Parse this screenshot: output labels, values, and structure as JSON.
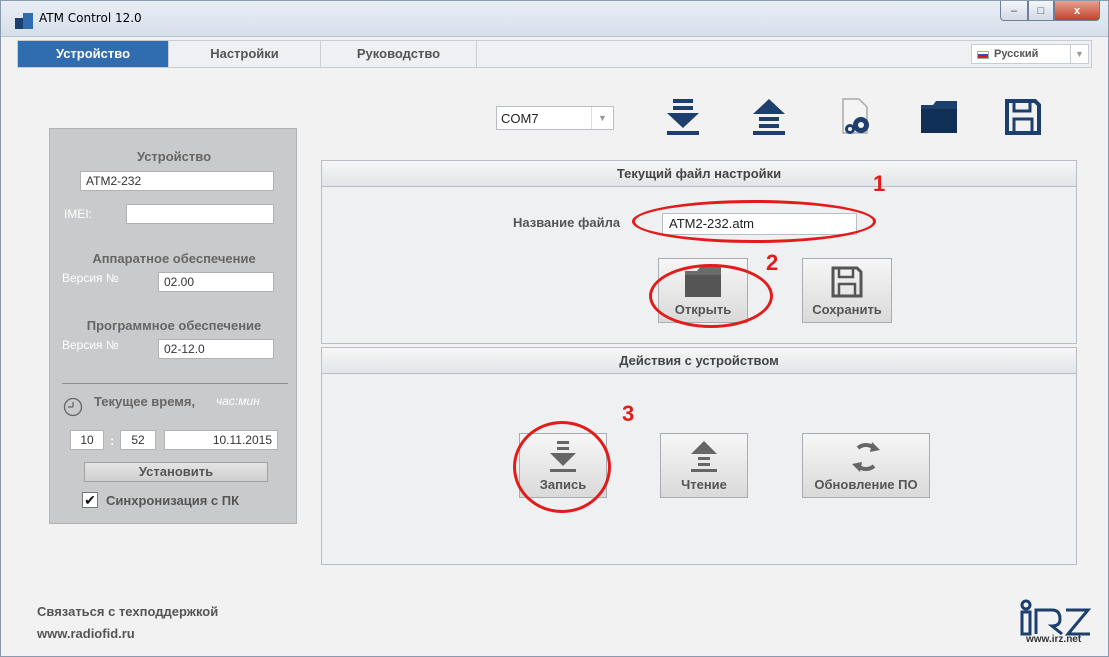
{
  "window": {
    "title": "ATM Control 12.0",
    "controls": {
      "minimize": "–",
      "maximize": "□",
      "close": "x"
    }
  },
  "tabs": [
    {
      "label": "Устройство",
      "active": true
    },
    {
      "label": "Настройки",
      "active": false
    },
    {
      "label": "Руководство",
      "active": false
    }
  ],
  "language": {
    "selected": "Русский"
  },
  "toolbar": {
    "port": "COM7",
    "icons": [
      "download-icon",
      "upload-icon",
      "file-settings-icon",
      "folder-icon",
      "floppy-save-icon"
    ]
  },
  "device_panel": {
    "device_heading": "Устройство",
    "device_name": "ATM2-232",
    "imei_label": "IMEI:",
    "imei_value": "",
    "hardware_heading": "Аппаратное обеспечение",
    "hardware_version_label": "Версия №",
    "hardware_version": "02.00",
    "software_heading": "Программное обеспечение",
    "software_version_label": "Версия №",
    "software_version": "02-12.0",
    "time_heading": "Текущее время,",
    "time_unit": "час:мин",
    "hour": "10",
    "colon": ":",
    "minute": "52",
    "date": "10.11.2015",
    "set_button": "Установить",
    "sync_label": "Синхронизация с ПК",
    "sync_checked": true,
    "check_mark": "✔"
  },
  "settings_file": {
    "header": "Текущий файл настройки",
    "filename_label": "Название файла",
    "filename": "ATM2-232.atm",
    "open_button": "Открыть",
    "save_button": "Сохранить"
  },
  "device_actions": {
    "header": "Действия с устройством",
    "write_button": "Запись",
    "read_button": "Чтение",
    "update_button": "Обновление ПО"
  },
  "annotations": [
    "1",
    "2",
    "3"
  ],
  "footer": {
    "support_label": "Связаться с техподдержкой",
    "website": "www.radiofid.ru",
    "logo_url": "www.irz.net"
  },
  "colors": {
    "accent": "#2f6cb0",
    "annotation": "#e31b1b",
    "panel": "#c9cacb",
    "icon": "#1c3f6e"
  }
}
